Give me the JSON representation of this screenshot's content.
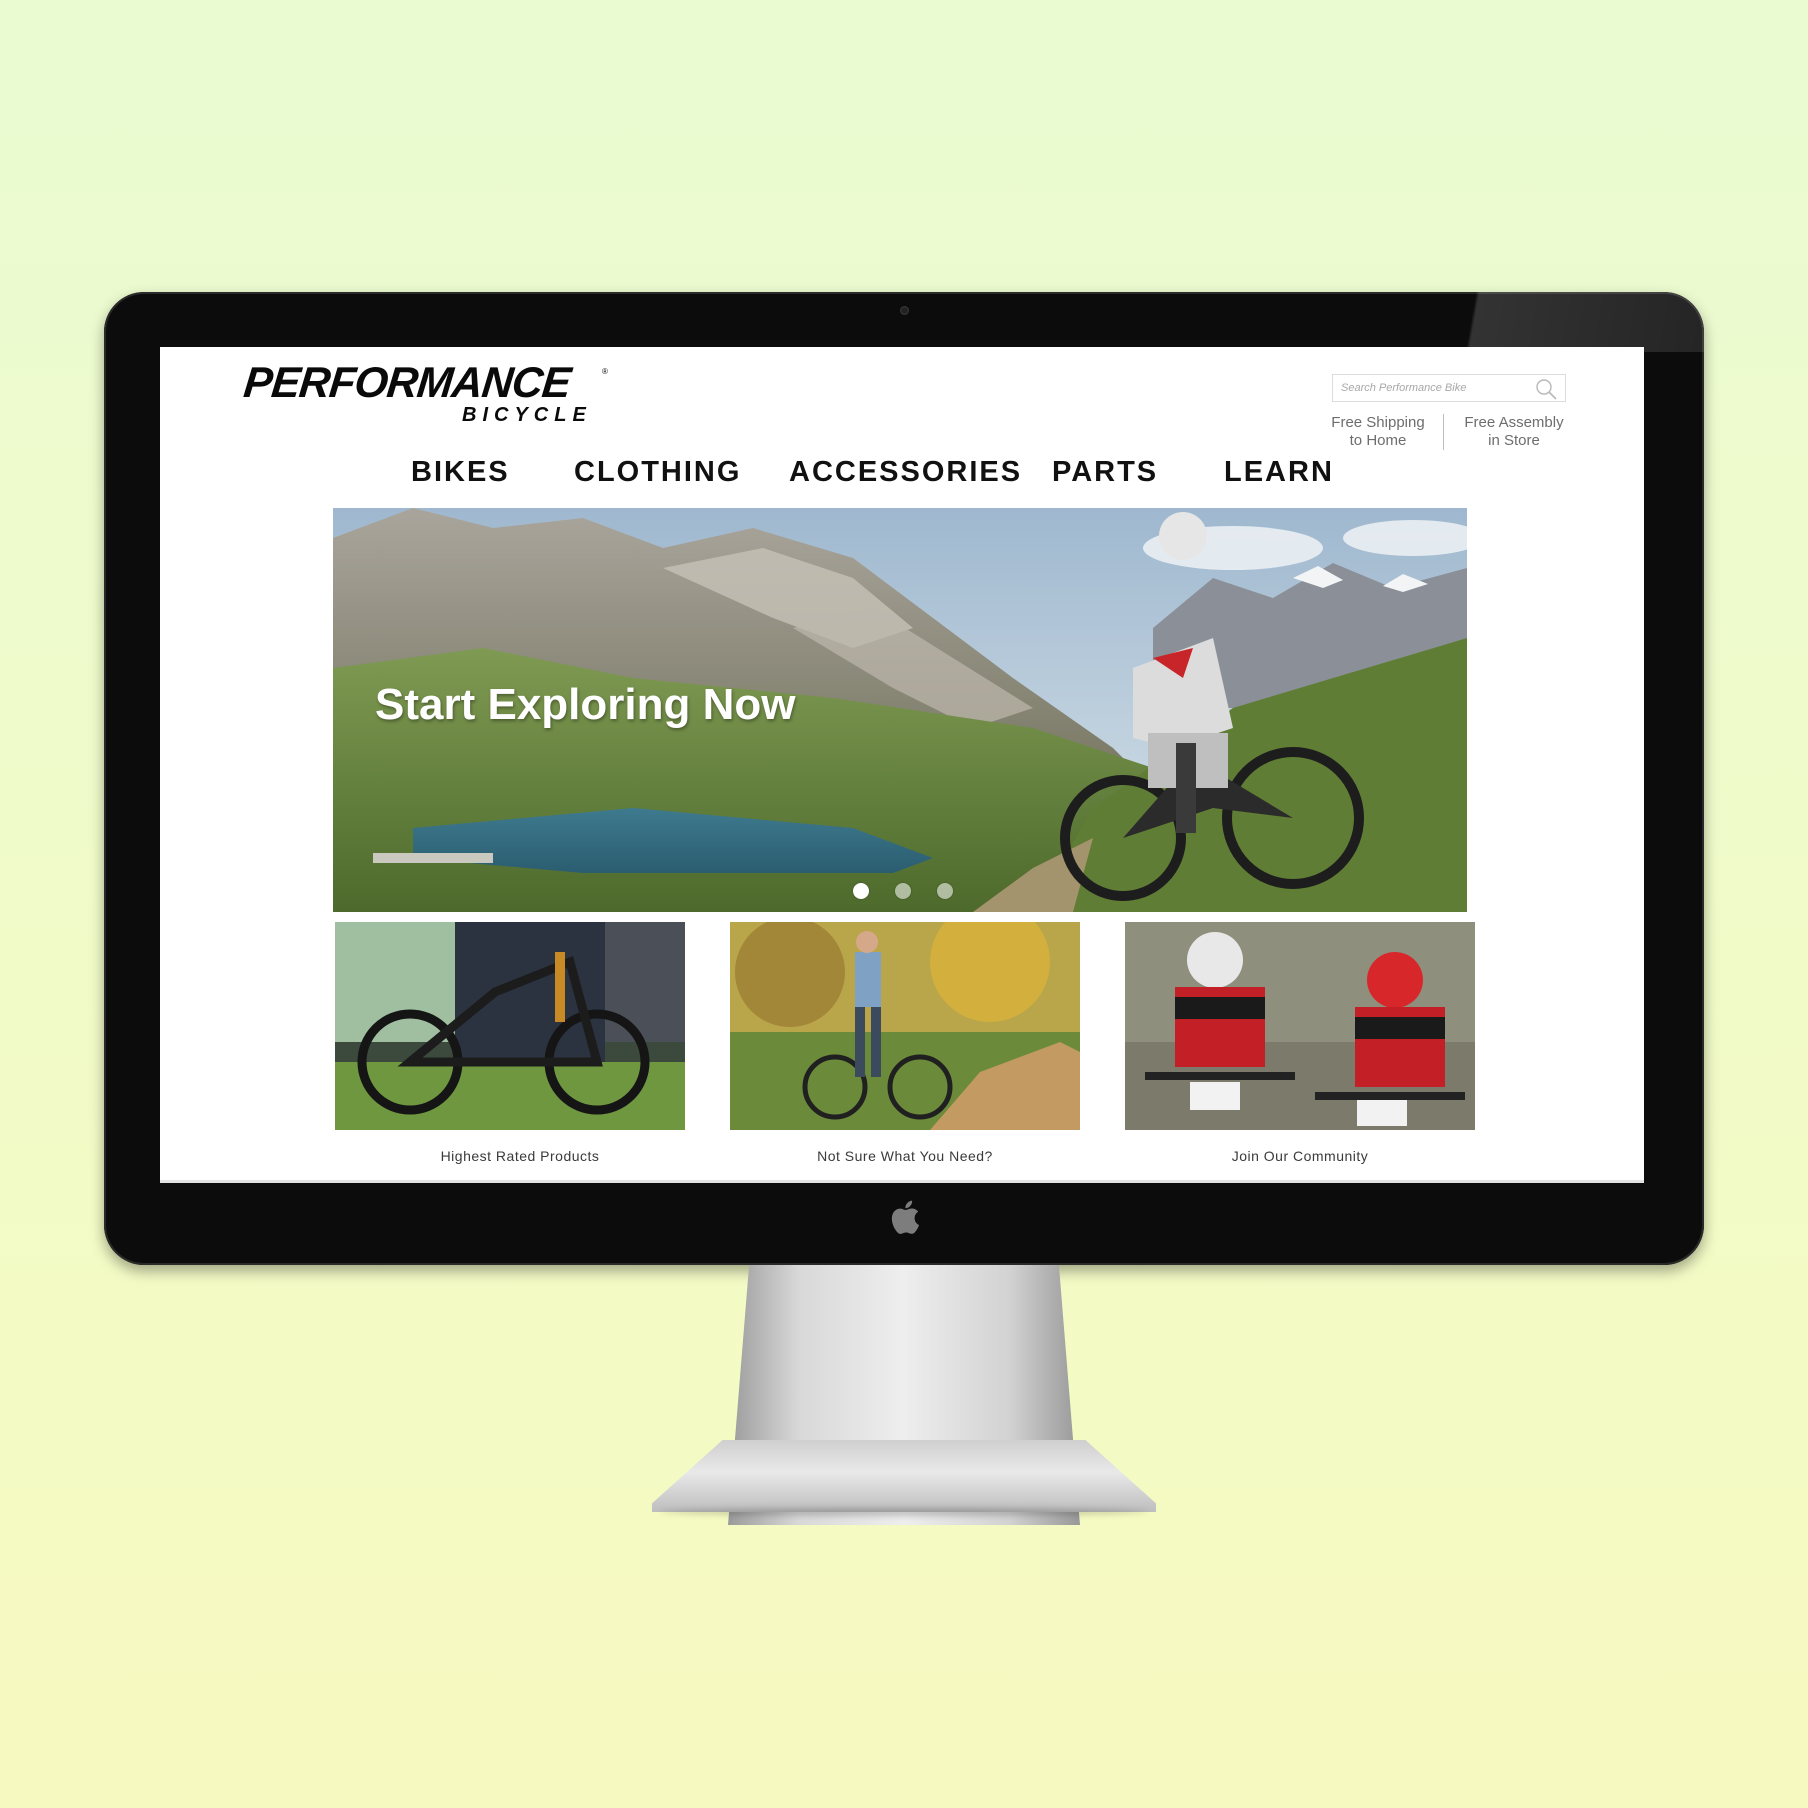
{
  "brand": {
    "name": "PERFORMANCE",
    "sub": "BICYCLE",
    "reg": "®"
  },
  "search": {
    "placeholder": "Search Performance Bike"
  },
  "perks": [
    {
      "line1": "Free Shipping",
      "line2": "to Home"
    },
    {
      "line1": "Free Assembly",
      "line2": "in Store"
    }
  ],
  "nav": {
    "items": [
      {
        "label": "BIKES"
      },
      {
        "label": "CLOTHING"
      },
      {
        "label": "ACCESSORIES"
      },
      {
        "label": "PARTS"
      },
      {
        "label": "LEARN"
      }
    ]
  },
  "hero": {
    "title": "Start Exploring Now",
    "slides": 3,
    "active_slide": 1
  },
  "tiles": [
    {
      "caption": "Highest Rated Products",
      "icon": "bike-photo"
    },
    {
      "caption": "Not Sure What You Need?",
      "icon": "rider-trail-photo"
    },
    {
      "caption": "Join Our Community",
      "icon": "racers-photo"
    }
  ],
  "colors": {
    "background_top": "#eafbd2",
    "background_bottom": "#f7fac0",
    "bezel": "#0c0c0c",
    "nav_text": "#111111",
    "caption_text": "#3a3a3a"
  }
}
